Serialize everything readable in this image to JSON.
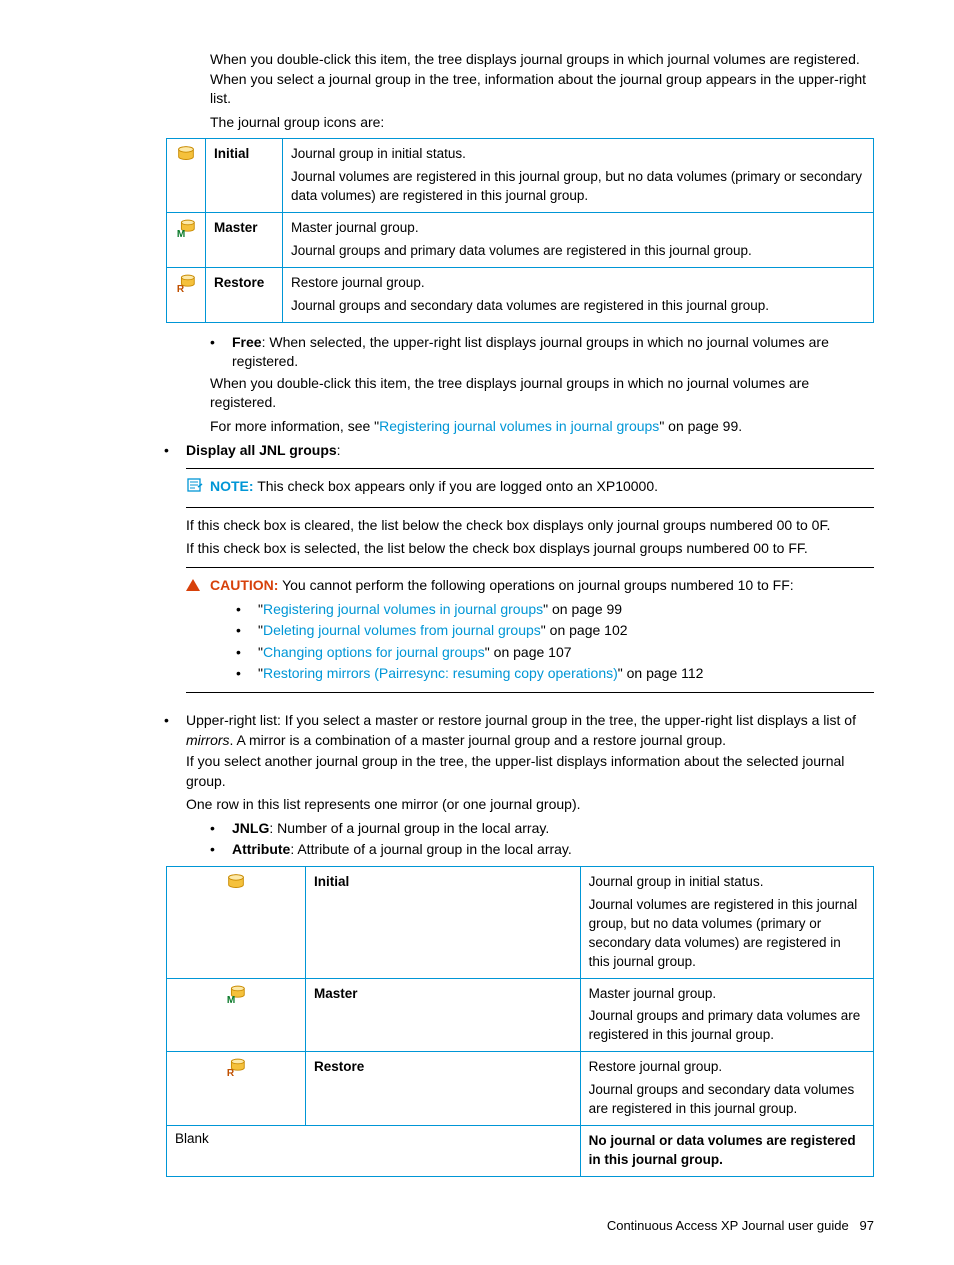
{
  "intro": {
    "p1": "When you double-click this item, the tree displays journal groups in which journal volumes are registered. When you select a journal group in the tree, information about the journal group appears in the upper-right list.",
    "p2": "The journal group icons are:"
  },
  "table1": {
    "r1": {
      "label": "Initial",
      "l1": "Journal group in initial status.",
      "l2": "Journal volumes are registered in this journal group, but no data volumes (primary or secondary data volumes) are registered in this journal group."
    },
    "r2": {
      "label": "Master",
      "l1": "Master journal group.",
      "l2": "Journal groups and primary data volumes are registered in this journal group."
    },
    "r3": {
      "label": "Restore",
      "l1": "Restore journal group.",
      "l2": "Journal groups and secondary data volumes are registered in this journal group."
    }
  },
  "free": {
    "label": "Free",
    "p1": ": When selected, the upper-right list displays journal groups in which no journal volumes are registered.",
    "p2": "When you double-click this item, the tree displays journal groups in which no journal volumes are registered.",
    "p3a": "For more information, see \"",
    "p3link": "Registering journal volumes in journal groups",
    "p3b": "\" on page 99."
  },
  "display": {
    "label": "Display all JNL groups",
    "colon": ":"
  },
  "note": {
    "label": "NOTE:",
    "text": "   This check box appears only if you are logged onto an XP10000."
  },
  "checkbox": {
    "p1": "If this check box is cleared, the list below the check box displays only journal groups numbered 00 to 0F.",
    "p2": "If this check box is selected, the list below the check box displays journal groups numbered 00 to FF."
  },
  "caution": {
    "label": "CAUTION:",
    "text": "   You cannot perform the following operations on journal groups numbered 10 to FF:",
    "b1a": "\"",
    "b1link": "Registering journal volumes in journal groups",
    "b1b": "\" on page 99",
    "b2a": "\"",
    "b2link": "Deleting journal volumes from journal groups",
    "b2b": "\" on page 102",
    "b3a": "\"",
    "b3link": "Changing options for journal groups",
    "b3b": "\" on page 107",
    "b4a": "\"",
    "b4link": "Restoring mirrors (Pairresync: resuming copy operations)",
    "b4b": "\" on page 112"
  },
  "upperright": {
    "p1a": "Upper-right list: If you select a master or restore journal group in the tree, the upper-right list displays a list of ",
    "p1i": "mirrors",
    "p1b": ". A mirror is a combination of a master journal group and a restore journal group.",
    "p2": "If you select another journal group in the tree, the upper-list displays information about the selected journal group.",
    "p3": "One row in this list represents one mirror (or one journal group).",
    "b1label": "JNLG",
    "b1text": ": Number of a journal group in the local array.",
    "b2label": "Attribute",
    "b2text": ": Attribute of a journal group in the local array."
  },
  "table2": {
    "r1": {
      "label": "Initial",
      "l1": "Journal group in initial status.",
      "l2": "Journal volumes are registered in this journal group, but no data volumes (primary or secondary data volumes) are registered in this journal group."
    },
    "r2": {
      "label": "Master",
      "l1": "Master journal group.",
      "l2": "Journal groups and primary data volumes are registered in this journal group."
    },
    "r3": {
      "label": "Restore",
      "l1": "Restore journal group.",
      "l2": "Journal groups and secondary data volumes are registered in this journal group."
    },
    "r4": {
      "label": "Blank",
      "l1": "No journal or data volumes are registered in this journal group."
    }
  },
  "footer": {
    "title": "Continuous Access XP Journal user guide",
    "page": "97"
  }
}
